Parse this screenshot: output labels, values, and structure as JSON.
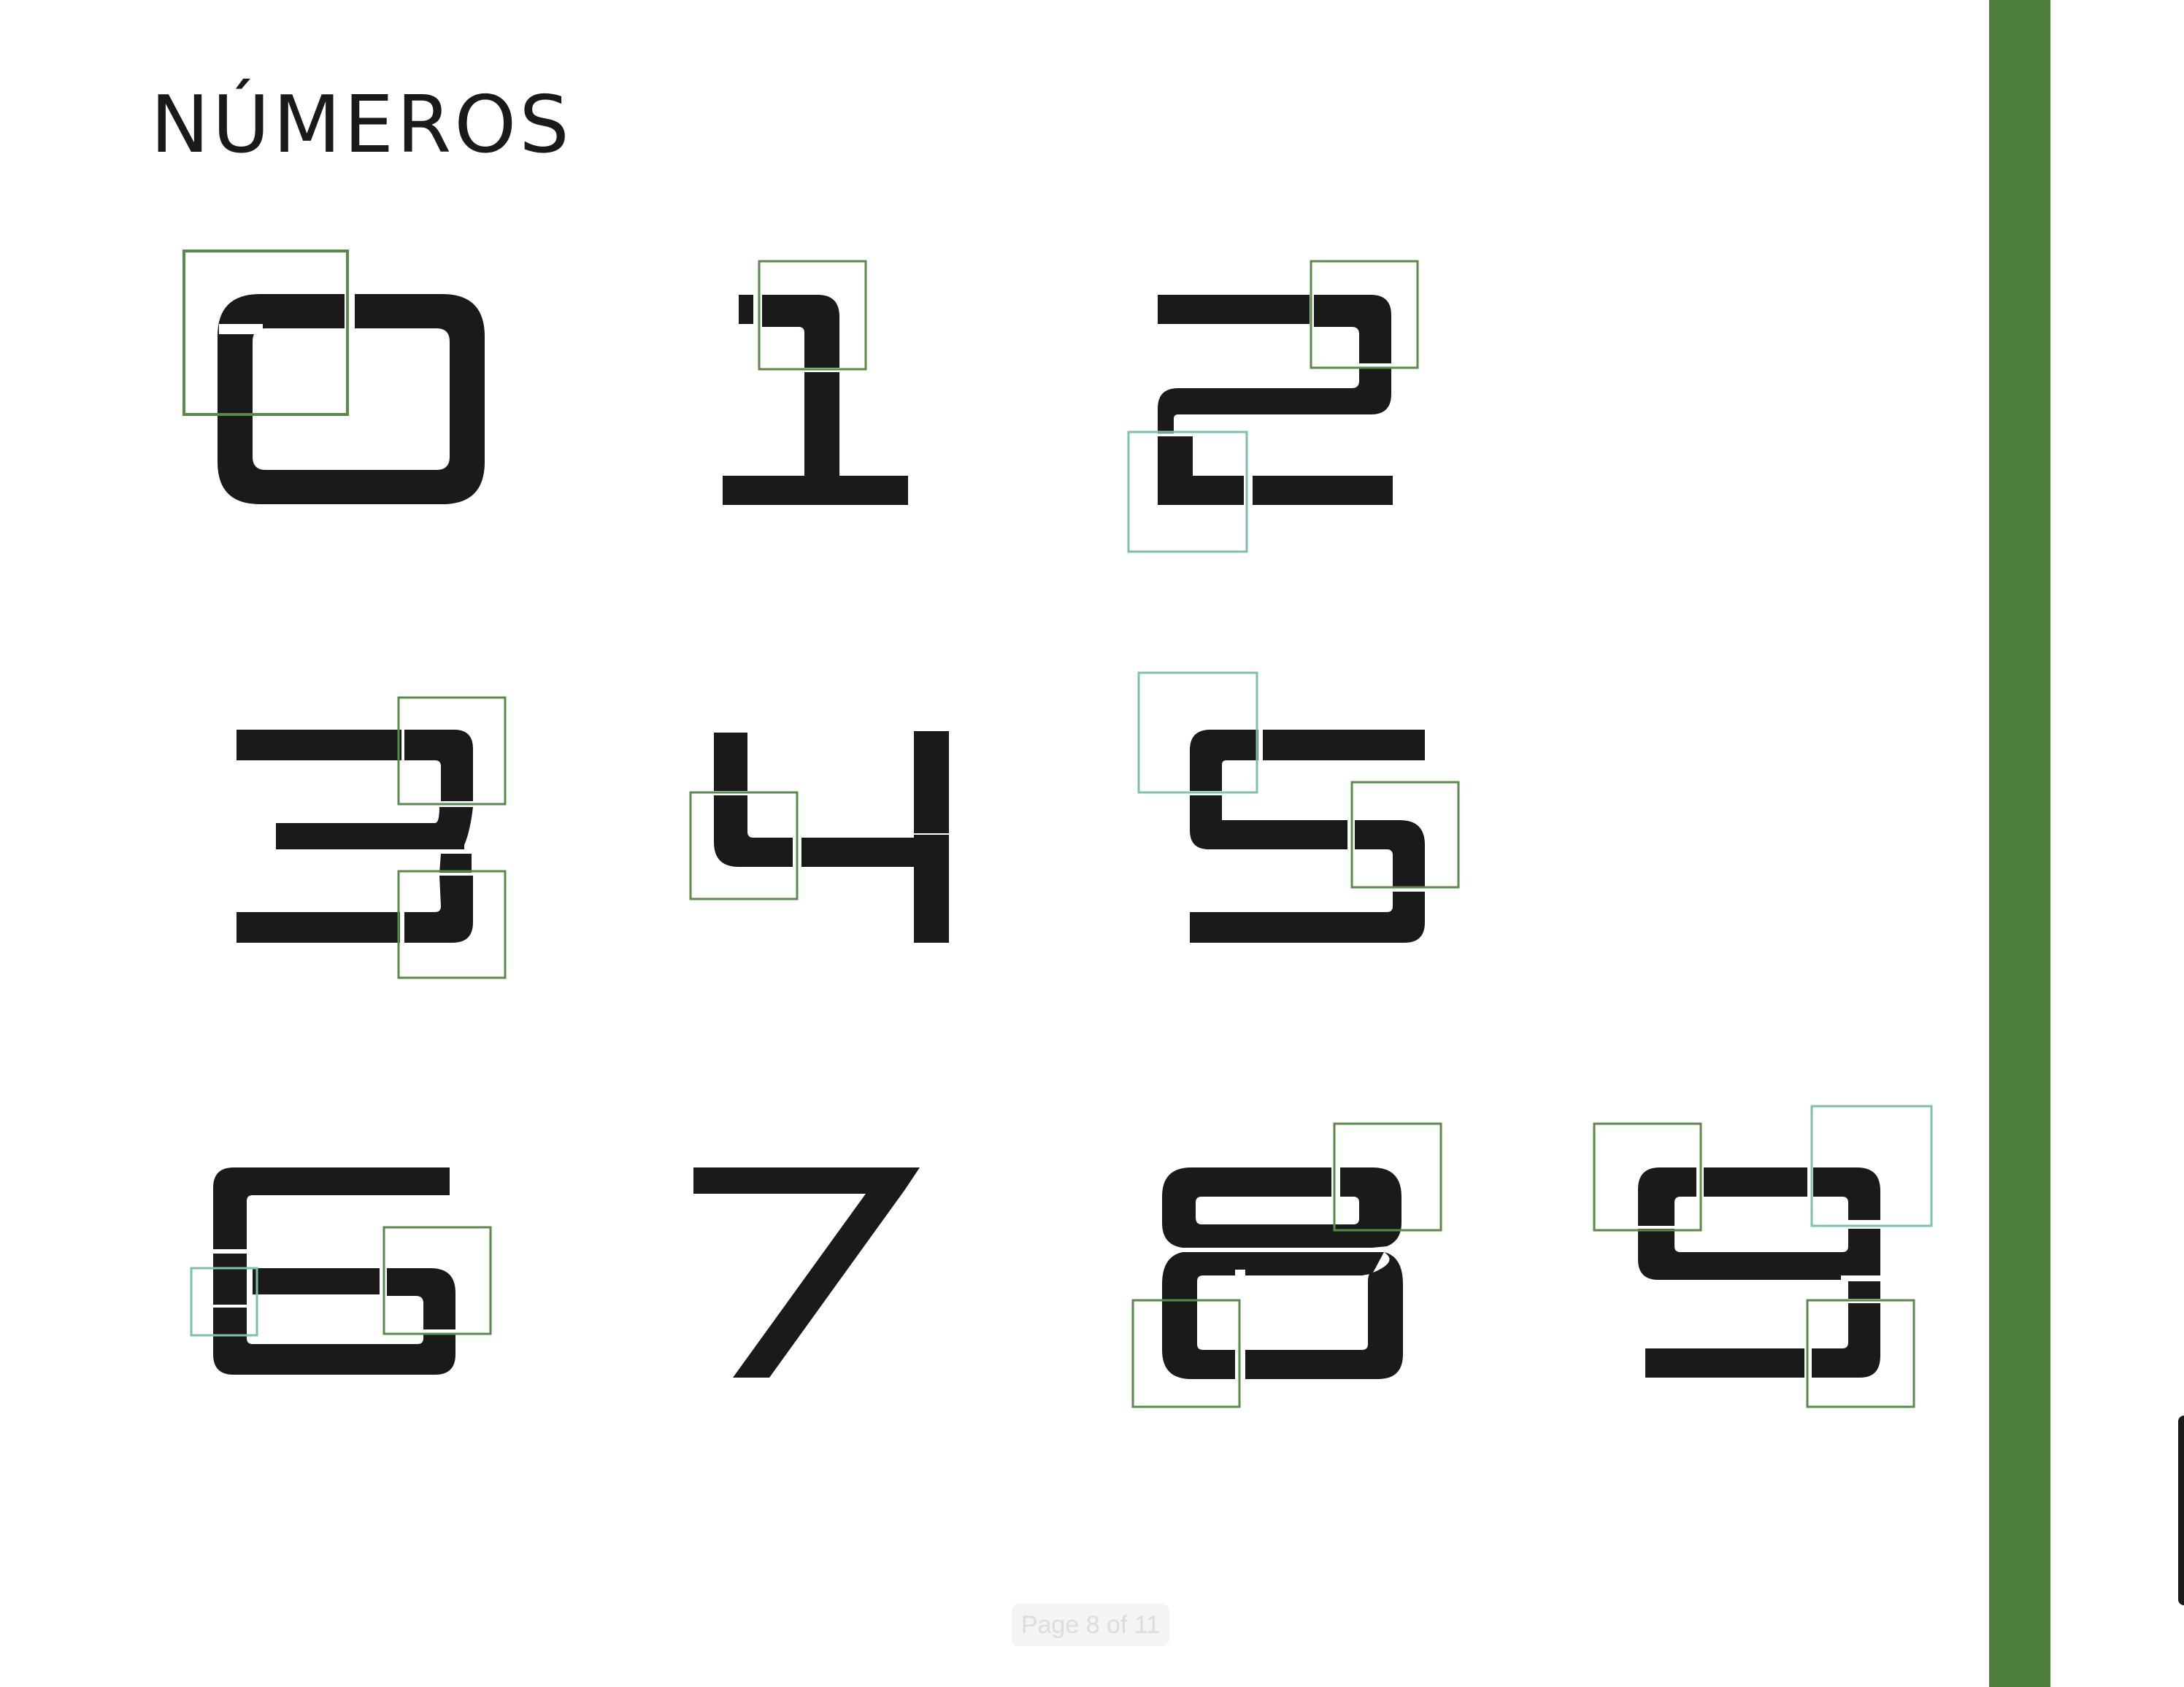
{
  "header": {
    "title": "NÚMEROS"
  },
  "footer": {
    "page_indicator": "Page 8 of 11"
  },
  "colors": {
    "accent": "#4e7f3d",
    "glyph": "#1a1a1a",
    "box_dark": "#5a8a4a",
    "box_teal": "#7cc0b0",
    "background": "#ffffff"
  },
  "numerals": [
    {
      "digit": "0"
    },
    {
      "digit": "1"
    },
    {
      "digit": "2"
    },
    {
      "digit": "3"
    },
    {
      "digit": "4"
    },
    {
      "digit": "5"
    },
    {
      "digit": "6"
    },
    {
      "digit": "7"
    },
    {
      "digit": "8"
    },
    {
      "digit": "9"
    }
  ]
}
